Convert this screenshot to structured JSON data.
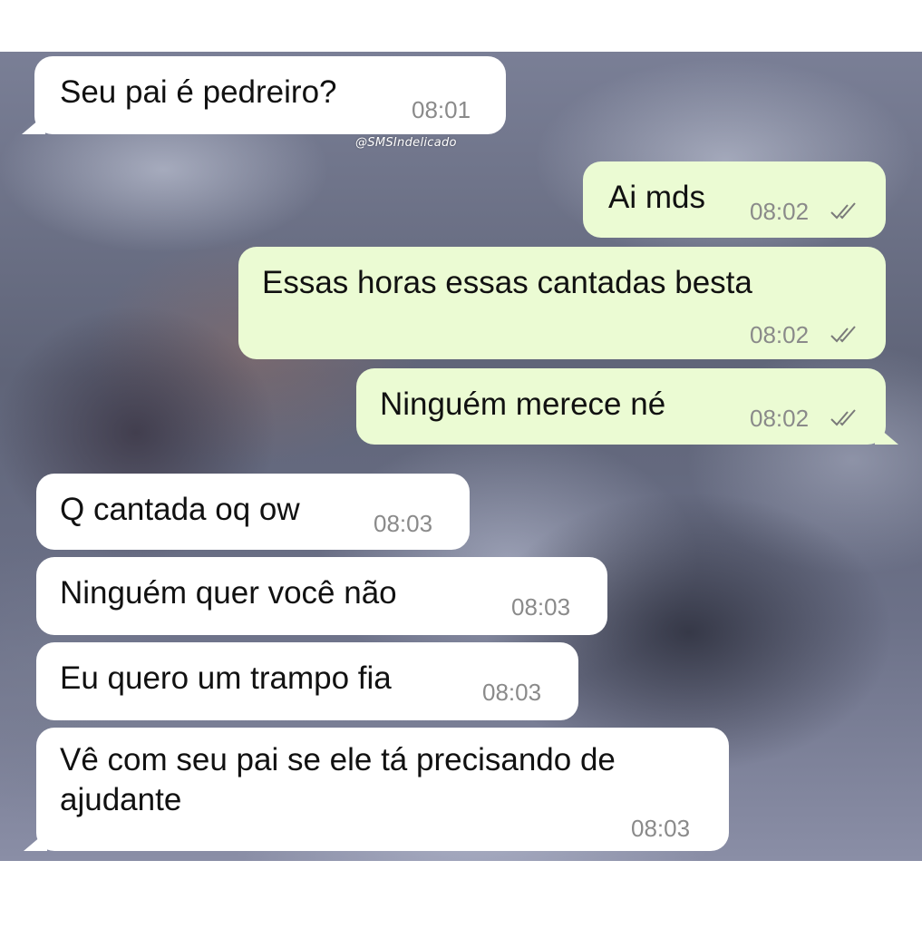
{
  "watermark": "@SMSIndelicado",
  "messages": [
    {
      "direction": "incoming",
      "text": "Seu pai é pedreiro?",
      "time": "08:01"
    },
    {
      "direction": "outgoing",
      "text": "Ai mds",
      "time": "08:02",
      "status": "read-double-check-icon"
    },
    {
      "direction": "outgoing",
      "text": "Essas horas essas cantadas besta",
      "time": "08:02",
      "status": "read-double-check-icon"
    },
    {
      "direction": "outgoing",
      "text": "Ninguém merece né",
      "time": "08:02",
      "status": "read-double-check-icon"
    },
    {
      "direction": "incoming",
      "text": "Q cantada oq ow",
      "time": "08:03"
    },
    {
      "direction": "incoming",
      "text": "Ninguém quer você não",
      "time": "08:03"
    },
    {
      "direction": "incoming",
      "text": "Eu quero um trampo fia",
      "time": "08:03"
    },
    {
      "direction": "incoming",
      "text": "Vê com seu pai se ele tá precisando de ajudante",
      "time": "08:03"
    }
  ],
  "colors": {
    "incoming_bubble": "#ffffff",
    "outgoing_bubble": "#ebfbd3",
    "timestamp": "#8a8a8a",
    "check_icon": "#7a7a7a"
  }
}
